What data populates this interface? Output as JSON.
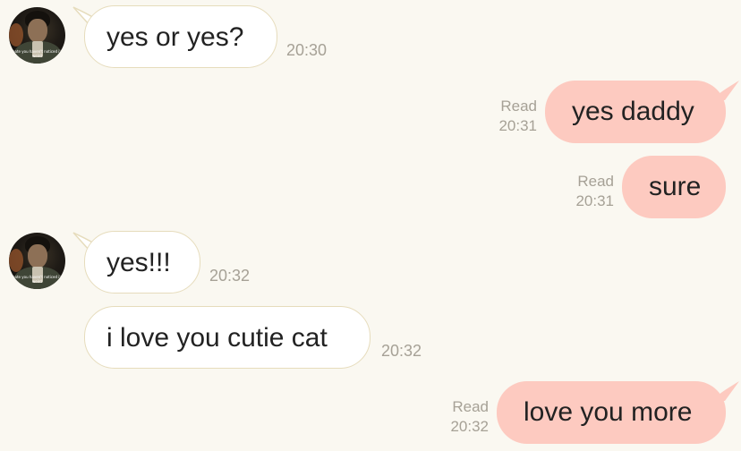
{
  "messages": [
    {
      "side": "in",
      "text": "yes or yes?",
      "time": "20:30",
      "avatar": "contact-avatar"
    },
    {
      "side": "out",
      "text": "yes daddy",
      "status": "Read",
      "time": "20:31"
    },
    {
      "side": "out",
      "text": "sure",
      "status": "Read",
      "time": "20:31"
    },
    {
      "side": "in",
      "text": "yes!!!",
      "time": "20:32",
      "avatar": "contact-avatar"
    },
    {
      "side": "in",
      "text": "i love you cutie cat",
      "time": "20:32"
    },
    {
      "side": "out",
      "text": "love you more",
      "status": "Read",
      "time": "20:32"
    }
  ],
  "avatar_caption": "i hate you haven't noticed i'm weird",
  "colors": {
    "background": "#faf8f1",
    "incoming_bubble": "#ffffff",
    "incoming_border": "#e6dcbc",
    "outgoing_bubble": "#fdcac0",
    "meta_text": "#a6a196"
  }
}
